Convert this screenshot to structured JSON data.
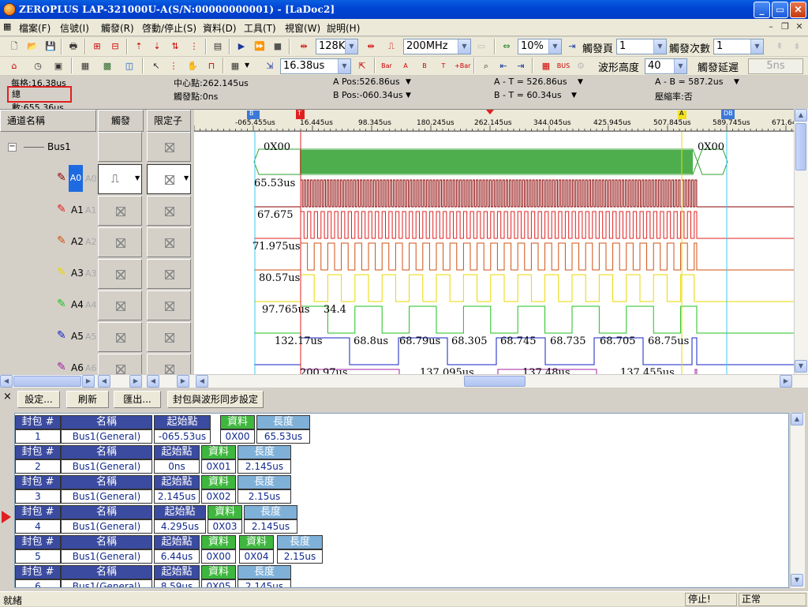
{
  "window": {
    "title": "ZEROPLUS LAP-321000U-A(S/N:00000000001) - [LaDoc2]",
    "min": "_",
    "max": "▭",
    "close": "✕"
  },
  "menu": [
    "檔案(F)",
    "信號(I)",
    "觸發(R)",
    "啓動/停止(S)",
    "資料(D)",
    "工具(T)",
    "視窗(W)",
    "說明(H)"
  ],
  "mdi": {
    "min": "–",
    "restore": "❐",
    "close": "✕"
  },
  "toolbar1": {
    "depth": "128K",
    "rate": "200MHz",
    "zoom": "10%",
    "trig_page_label": "觸發頁",
    "trig_page": "1",
    "trig_count_label": "觸發次數",
    "trig_count": "1"
  },
  "toolbar2": {
    "time": "16.38us",
    "wave_height_label": "波形高度",
    "wave_height": "40",
    "trig_delay_label": "觸發延遲",
    "trig_delay": "5ns"
  },
  "info": {
    "per_div": "每格:16.38us",
    "total": "總數:655.36us",
    "center": "中心點:262.145us",
    "trigger": "觸發點:0ns",
    "a_pos": "A Pos:526.86us",
    "b_pos": "B Pos:-060.34us",
    "a_t": "A - T = 526.86us",
    "b_t": "B - T = 60.34us",
    "a_b": "A - B = 587.2us",
    "compress": "壓縮率:否"
  },
  "channel_panel": {
    "col_name": "通道名稱",
    "col_trigger": "觸發",
    "col_qualifier": "限定子",
    "bus": "Bus1",
    "channels": [
      {
        "name": "A0",
        "ghost": "A0",
        "color": "#8b0000"
      },
      {
        "name": "A1",
        "ghost": "A1",
        "color": "#e02020"
      },
      {
        "name": "A2",
        "ghost": "A2",
        "color": "#d05010"
      },
      {
        "name": "A3",
        "ghost": "A3",
        "color": "#e8d800"
      },
      {
        "name": "A4",
        "ghost": "A4",
        "color": "#20c020"
      },
      {
        "name": "A5",
        "ghost": "A5",
        "color": "#1020c0"
      },
      {
        "name": "A6",
        "ghost": "A6",
        "color": "#a020a0"
      }
    ]
  },
  "ruler": {
    "ticks": [
      "-065.455us",
      "16.445us",
      "98.345us",
      "180.245us",
      "262.145us",
      "344.045us",
      "425.945us",
      "507.845us",
      "589.745us",
      "671.64"
    ],
    "markers": {
      "b": "B",
      "t": "T",
      "a": "A",
      "db": "DB"
    }
  },
  "waves": {
    "bus_start": "0X00",
    "bus_end": "0X00",
    "a0": "65.53us",
    "a1": "67.675",
    "a2": "71.975us",
    "a3": "80.57us",
    "a4": [
      "97.765us",
      "34.4"
    ],
    "a5": [
      "132.17us",
      "68.8us",
      "68.79us",
      "68.305",
      "68.745",
      "68.735",
      "68.705",
      "68.75us"
    ],
    "a6": [
      "200.97us",
      "137.095us",
      "137.48us",
      "137.455us"
    ]
  },
  "lower_panel": {
    "close": "×",
    "buttons": [
      "設定...",
      "刷新",
      "匯出...",
      "封包與波形同步設定"
    ]
  },
  "packets": {
    "headers": {
      "num": "封包 #",
      "name": "名稱",
      "start": "起始點",
      "data": "資料",
      "len": "長度"
    },
    "rows": [
      {
        "num": "1",
        "name": "Bus1(General)",
        "start": "-065.53us",
        "data": [
          "0X00"
        ],
        "len": "65.53us"
      },
      {
        "num": "2",
        "name": "Bus1(General)",
        "start": "0ns",
        "data": [
          "0X01"
        ],
        "len": "2.145us"
      },
      {
        "num": "3",
        "name": "Bus1(General)",
        "start": "2.145us",
        "data": [
          "0X02"
        ],
        "len": "2.15us"
      },
      {
        "num": "4",
        "name": "Bus1(General)",
        "start": "4.295us",
        "data": [
          "0X03"
        ],
        "len": "2.145us"
      },
      {
        "num": "5",
        "name": "Bus1(General)",
        "start": "6.44us",
        "data": [
          "0X00",
          "0X04"
        ],
        "len": "2.15us"
      },
      {
        "num": "6",
        "name": "Bus1(General)",
        "start": "8.59us",
        "data": [
          "0X05"
        ],
        "len": "2.145us"
      }
    ]
  },
  "status": {
    "left": "就緒",
    "stop": "停止!",
    "mode": "正常"
  },
  "colors": {
    "title_bar": "#0046d5",
    "grid_line": "#7fd8f0",
    "trigger_line": "#e02020",
    "cursor_a": "#e8d800"
  }
}
